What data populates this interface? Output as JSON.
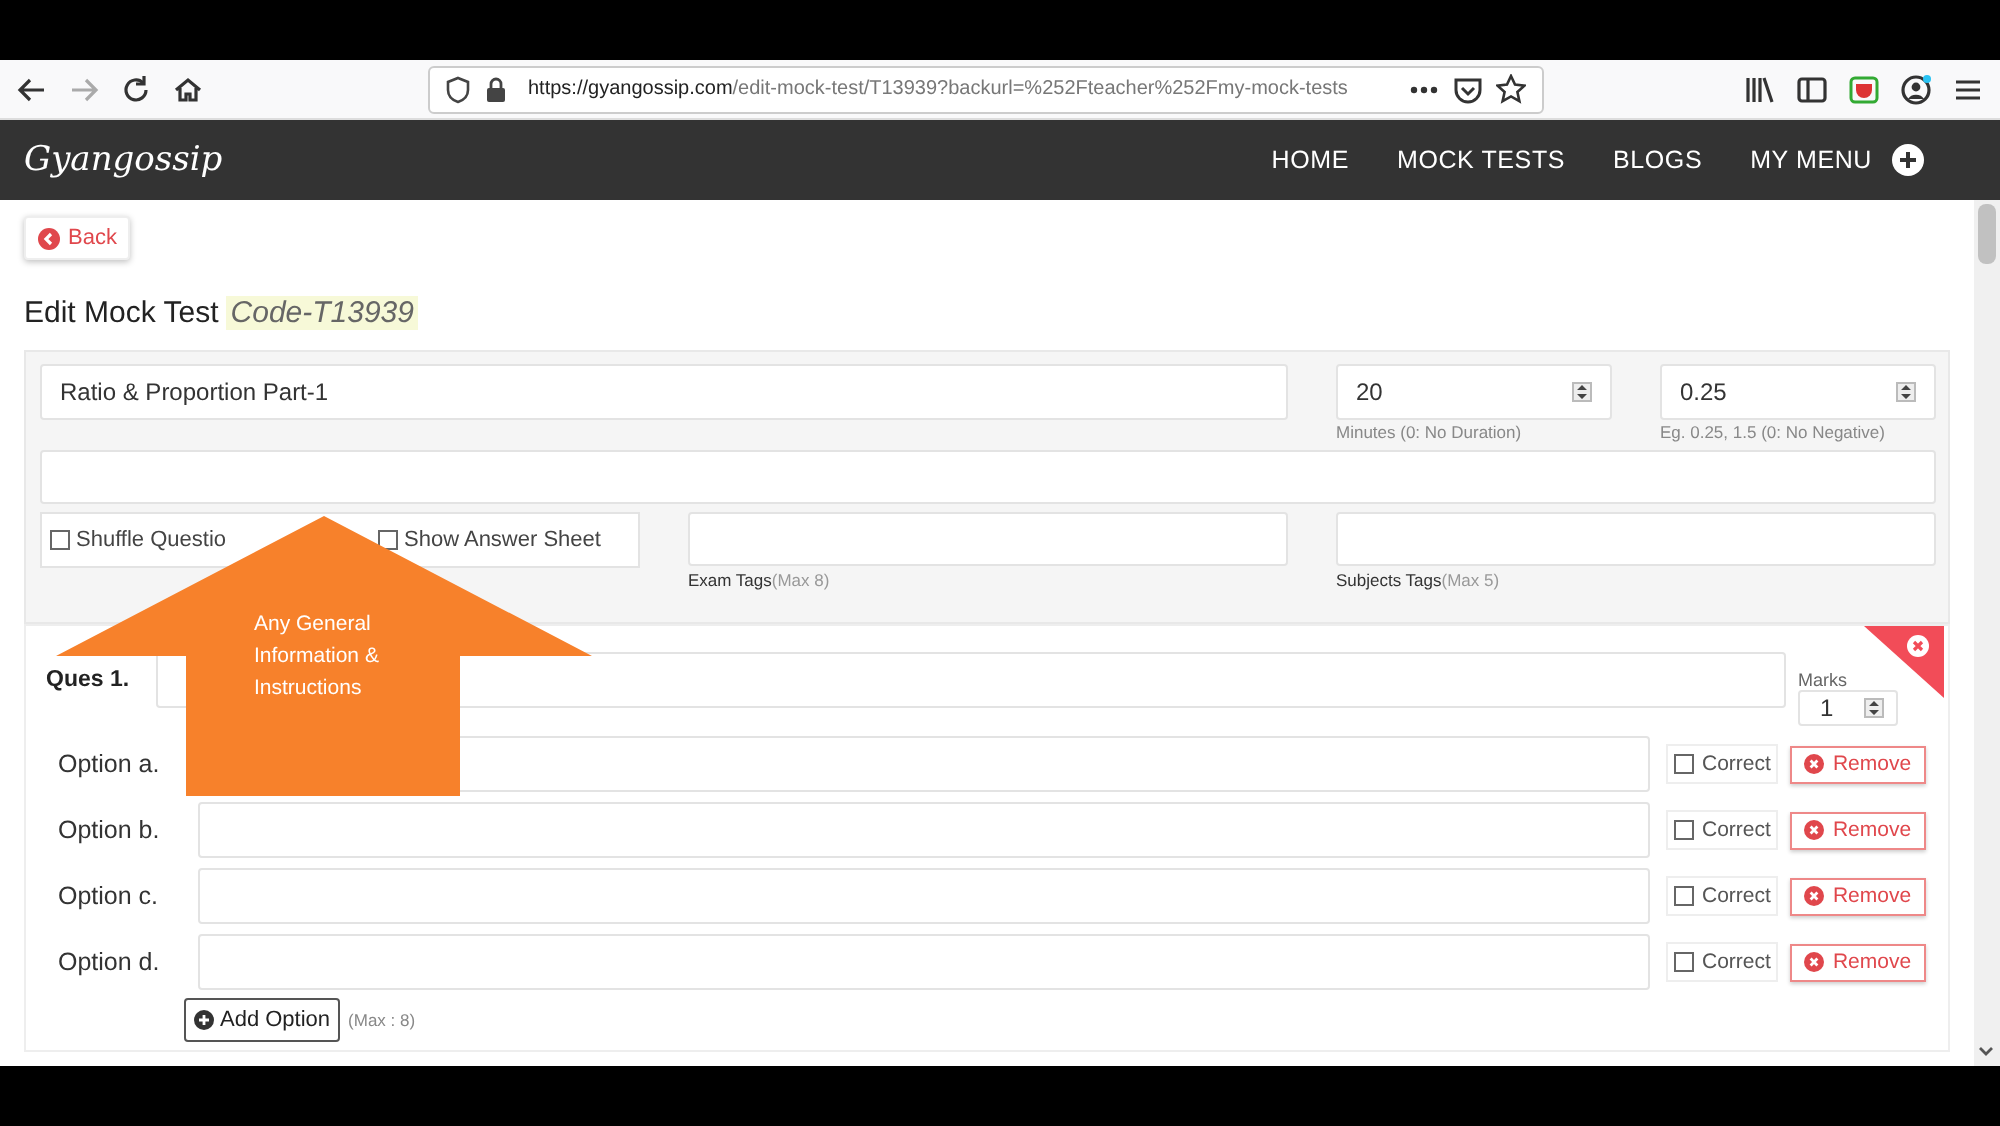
{
  "browser": {
    "url_domain": "https://gyangossip.com",
    "url_path": "/edit-mock-test/T13939?backurl=%252Fteacher%252Fmy-mock-tests",
    "forward_disabled": true
  },
  "site": {
    "logo": "Gyangossip",
    "nav": [
      {
        "label": "HOME"
      },
      {
        "label": "MOCK TESTS"
      },
      {
        "label": "BLOGS"
      },
      {
        "label": "MY MENU"
      }
    ]
  },
  "back_button": "Back",
  "heading": {
    "title": "Edit Mock Test",
    "code": "Code-T13939"
  },
  "form": {
    "title_value": "Ratio & Proportion Part-1",
    "duration": {
      "value": "20",
      "hint": "Minutes (0: No Duration)"
    },
    "negative": {
      "value": "0.25",
      "hint": "Eg. 0.25, 1.5 (0: No Negative)"
    },
    "checkboxes": [
      {
        "label": "Shuffle Questio",
        "checked": false
      },
      {
        "label": "Show Answer Sheet",
        "checked": false
      }
    ],
    "exam_tags": {
      "label": "Exam Tags",
      "max": "(Max 8)"
    },
    "subject_tags": {
      "label": "Subjects Tags",
      "max": "(Max 5)"
    }
  },
  "question": {
    "label": "Ques 1.",
    "marks_label": "Marks",
    "marks_value": "1",
    "options": [
      {
        "label": "Option a.",
        "correct": false,
        "correct_label": "Correct",
        "remove": "Remove"
      },
      {
        "label": "Option b.",
        "correct": false,
        "correct_label": "Correct",
        "remove": "Remove"
      },
      {
        "label": "Option c.",
        "correct": false,
        "correct_label": "Correct",
        "remove": "Remove"
      },
      {
        "label": "Option d.",
        "correct": false,
        "correct_label": "Correct",
        "remove": "Remove"
      }
    ],
    "add_option": "Add Option",
    "add_max": "(Max : 8)"
  },
  "annotation": {
    "text": "Any General Information & Instructions"
  }
}
